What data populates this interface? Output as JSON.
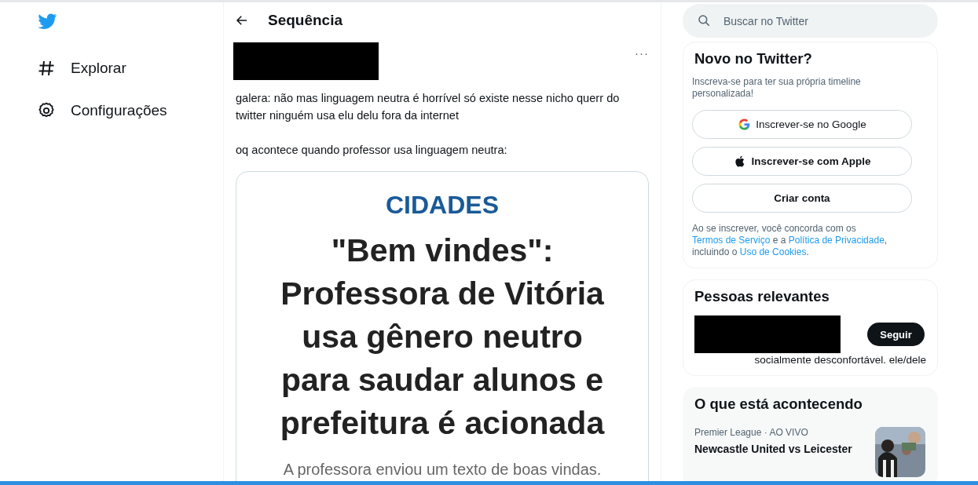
{
  "nav": [
    {
      "label": "Explorar"
    },
    {
      "label": "Configurações"
    }
  ],
  "header": {
    "title": "Sequência"
  },
  "tweet": {
    "more": "···",
    "text": "galera: não mas linguagem neutra é horrível só existe nesse nicho querr do twitter ninguém usa elu delu fora da internet\n\noq acontece quando professor usa linguagem neutra:",
    "article": {
      "section": "CIDADES",
      "headline": "\"Bem vindes\": Professora de Vitória usa gênero neutro para saudar alunos e prefeitura é acionada",
      "lead": "A professora enviou um texto de boas vindas."
    }
  },
  "search": {
    "placeholder": "Buscar no Twitter"
  },
  "signup": {
    "title": "Novo no Twitter?",
    "subtitle": "Inscreva-se para ter sua própria timeline personalizada!",
    "buttons": [
      {
        "label": "Inscrever-se no Google"
      },
      {
        "label": "Inscrever-se com Apple"
      },
      {
        "label": "Criar conta"
      }
    ],
    "legal": [
      {
        "text": "Ao se inscrever, você concorda com os ",
        "link": false
      },
      {
        "text": "Termos de Serviço",
        "link": true
      },
      {
        "text": " e a ",
        "link": false
      },
      {
        "text": "Política de Privacidade",
        "link": true
      },
      {
        "text": ", incluindo o ",
        "link": false
      },
      {
        "text": "Uso de Cookies",
        "link": true
      },
      {
        "text": ".",
        "link": false
      }
    ]
  },
  "relevant": {
    "title": "Pessoas relevantes",
    "follow": "Seguir",
    "bio": "socialmente desconfortável. ele/dele"
  },
  "trends": {
    "title": "O que está acontecendo",
    "items": [
      {
        "context": "Premier League · AO VIVO",
        "title": "Newcastle United vs Leicester",
        "kind": "picture"
      }
    ]
  }
}
